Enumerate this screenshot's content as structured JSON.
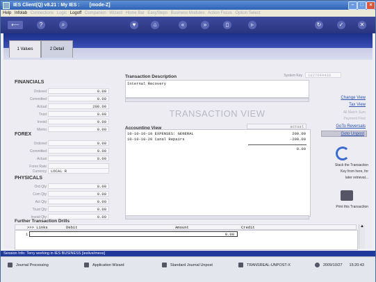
{
  "window": {
    "title": "IES Client(Q) v8.21 : My IES :",
    "mode": "[mode-Z]"
  },
  "menu": {
    "items": [
      "Help",
      "Infolab",
      "Connections",
      "Logic",
      "Logoff",
      "Companion",
      "Wizard",
      "Home Bar",
      "EasySteps",
      "Business Modules",
      "Action Focus",
      "Option Select"
    ]
  },
  "tabs": [
    {
      "label": "1 Values"
    },
    {
      "label": "2 Detail"
    }
  ],
  "financials": {
    "header": "FINANCIALS",
    "rows": [
      {
        "label": "Ordered",
        "value": "0.00"
      },
      {
        "label": "Committed",
        "value": "0.00"
      },
      {
        "label": "Actual",
        "value": "200.00"
      },
      {
        "label": "Trust",
        "value": "0.00"
      },
      {
        "label": "Invoid",
        "value": "0.00"
      },
      {
        "label": "Memo",
        "value": "0.00"
      }
    ]
  },
  "forex": {
    "header": "FOREX",
    "rows": [
      {
        "label": "Ordered",
        "value": "0.00"
      },
      {
        "label": "Committed",
        "value": "0.00"
      },
      {
        "label": "Actual",
        "value": "0.00"
      },
      {
        "label": "Forex Rate",
        "value": ""
      },
      {
        "label": "Currency",
        "value": "LOCAL R"
      }
    ]
  },
  "physicals": {
    "header": "PHYSICALS",
    "rows": [
      {
        "label": "Ord Qty",
        "value": "0.00"
      },
      {
        "label": "Com Qty",
        "value": "0.00"
      },
      {
        "label": "Act Qty",
        "value": "0.00"
      },
      {
        "label": "Trust Qty",
        "value": "0.00"
      },
      {
        "label": "Invoid Qty",
        "value": "0.00"
      }
    ]
  },
  "transaction": {
    "description_header": "Transaction Description",
    "description_value": "Internal Recovery",
    "system_key_label": "System Key",
    "system_key_value": "1027044438",
    "view_title": "TRANSACTION VIEW"
  },
  "accounting": {
    "header": "Accounting View",
    "col_actual": "actual",
    "rows": [
      {
        "account": "10-10-10-10 EXPENSES: GENERAL",
        "amount": "200.00"
      },
      {
        "account": "10-10-10-20 Canal Repairs",
        "amount": "-200.00"
      }
    ],
    "total": "0.00"
  },
  "right_panel": {
    "links": [
      "Change View",
      "Tax View"
    ],
    "dim_items": [
      "All Match Sum",
      "Payment Flow"
    ],
    "reversals_link": "GoTo Reversals",
    "unpost_button": "Goto Unpost",
    "stack_text": [
      "Stack the Transaction",
      "Key from here, for",
      "later retrieval..."
    ],
    "print_text": "Print this Transaction"
  },
  "drills": {
    "header": "Further Transaction Drills",
    "columns": [
      ">>> Links",
      "Debit",
      "Amount",
      "Credit"
    ],
    "row_index": "1",
    "row_amount": "0.00"
  },
  "status": {
    "text": "Session Info: Terry working in IES BUSINESS   [ieslive/mess]"
  },
  "taskbar": {
    "items": [
      "Journal Processing",
      "Application Wizard",
      "Standard Journal Unpost",
      "TRANSREAL-UNPOST-X"
    ],
    "date": "2009/10/27",
    "time": "15:20:43"
  }
}
